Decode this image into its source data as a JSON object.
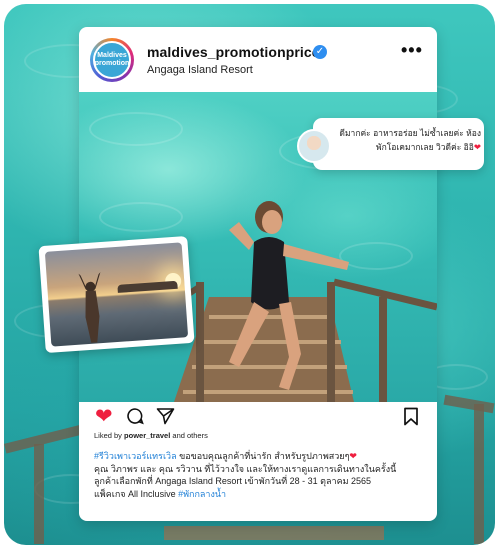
{
  "post": {
    "username": "maldives_promotionprice",
    "location": "Angaga Island Resort",
    "avatar_text": "Maldives\npromotion",
    "verified_icon": "verified-badge-icon",
    "more_icon": "more-options-icon",
    "likes_prefix": "Liked by ",
    "likes_user": "power_travel",
    "likes_suffix": " and others",
    "caption_tag1": "#รีวิวเพาเวอร์แทรเวิล",
    "caption_line1": " ขอขอบคุณลูกค้าที่น่ารัก สำหรับรูปภาพสวยๆ",
    "caption_heart": "❤",
    "caption_line2": "คุณ วิภาพร และ คุณ รวิวาน ที่ไว้วางใจ และให้ทางเราดูแลการเดินทางในครั้งนี้",
    "caption_line3": "ลูกค้าเลือกพักที่ Angaga Island Resort เข้าพักวันที่ 28 - 31 ตุลาคม 2565",
    "caption_line4": "แพ็คเกจ All Inclusive ",
    "caption_tag2": "#พักกลางน้ำ"
  },
  "comment": {
    "line1": "ดีมากค่ะ อาหารอร่อย ไม่ซ้ำเลยค่ะ ห้อง",
    "line2": "พักโอเคมากเลย วิวดีค่ะ อิอิ",
    "heart": "❤"
  },
  "colors": {
    "heart": "#ef1f3f",
    "verified": "#2e8ef0",
    "hashtag": "#1e7fd6",
    "water": "#2fb5b0"
  }
}
